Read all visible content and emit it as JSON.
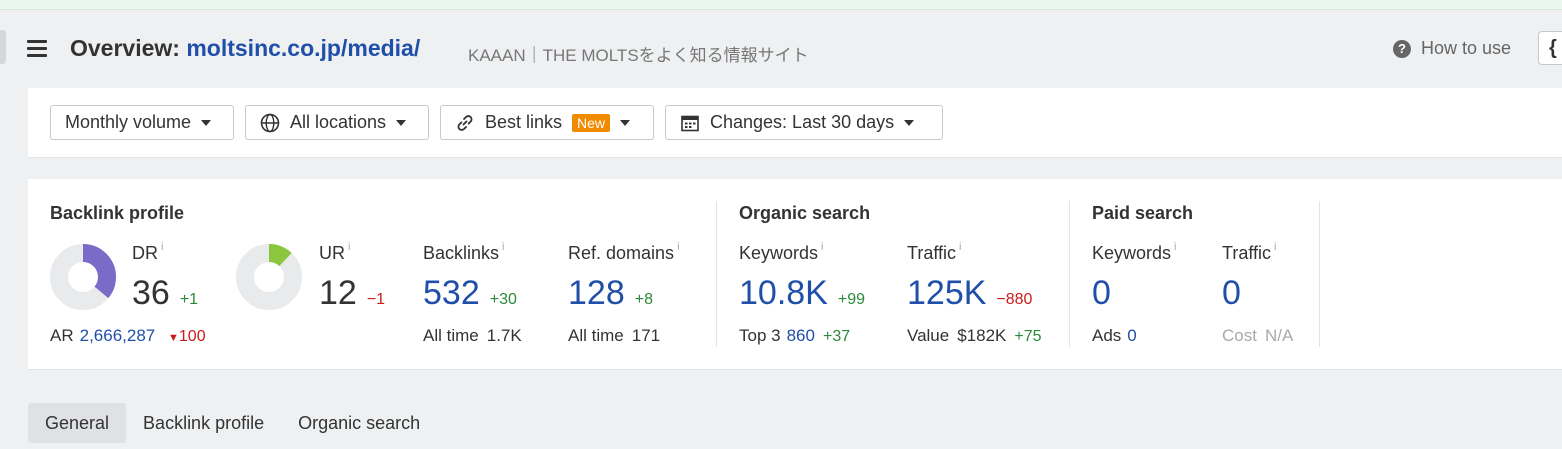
{
  "header": {
    "title_prefix": "Overview:",
    "title_url": "moltsinc.co.jp/media/",
    "subtitle": "KAAAN｜THE MOLTSをよく知る情報サイト",
    "how_to_use": "How to use",
    "corner_button": "{"
  },
  "toolbar": {
    "volume": "Monthly volume",
    "locations": "All locations",
    "best_links": "Best links",
    "best_links_badge": "New",
    "changes": "Changes: Last 30 days"
  },
  "backlink_profile": {
    "title": "Backlink profile",
    "dr": {
      "label": "DR",
      "value": "36",
      "delta": "+1",
      "fill_fraction": 0.36
    },
    "ur": {
      "label": "UR",
      "value": "12",
      "delta": "−1",
      "fill_fraction": 0.12
    },
    "ar": {
      "label": "AR",
      "value": "2,666,287",
      "delta": "100"
    },
    "backlinks": {
      "label": "Backlinks",
      "value": "532",
      "delta": "+30",
      "all_time_label": "All time",
      "all_time_value": "1.7K"
    },
    "ref_domains": {
      "label": "Ref. domains",
      "value": "128",
      "delta": "+8",
      "all_time_label": "All time",
      "all_time_value": "171"
    }
  },
  "organic_search": {
    "title": "Organic search",
    "keywords": {
      "label": "Keywords",
      "value": "10.8K",
      "delta": "+99",
      "top3_label": "Top 3",
      "top3_value": "860",
      "top3_delta": "+37"
    },
    "traffic": {
      "label": "Traffic",
      "value": "125K",
      "delta": "−880",
      "value_label": "Value",
      "value_value": "$182K",
      "value_delta": "+75"
    }
  },
  "paid_search": {
    "title": "Paid search",
    "keywords": {
      "label": "Keywords",
      "value": "0",
      "ads_label": "Ads",
      "ads_value": "0"
    },
    "traffic": {
      "label": "Traffic",
      "value": "0",
      "cost_label": "Cost",
      "cost_value": "N/A"
    }
  },
  "info_icon": "i",
  "tabs": [
    "General",
    "Backlink profile",
    "Organic search"
  ],
  "colors": {
    "accent_blue": "#1f4fa8",
    "dr_donut": "#7b6bc9",
    "ur_donut": "#8cc63f",
    "donut_track": "#e8eaec",
    "positive": "#2a8a3a",
    "negative": "#cc1a1a",
    "badge": "#f08a00"
  }
}
